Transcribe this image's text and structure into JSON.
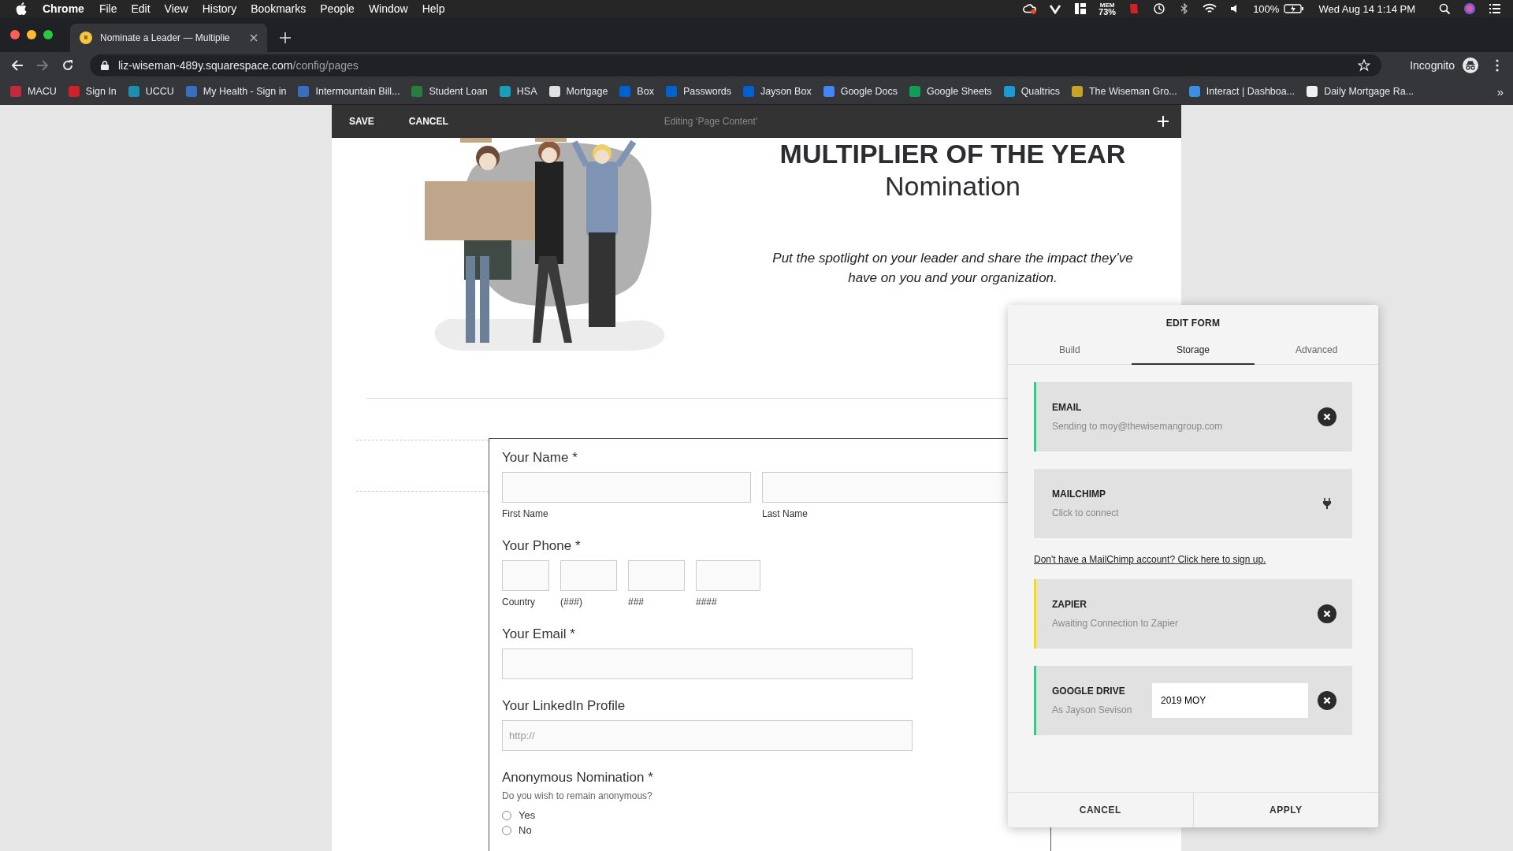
{
  "menu_bar": {
    "app": "Chrome",
    "menus": [
      "File",
      "Edit",
      "View",
      "History",
      "Bookmarks",
      "People",
      "Window",
      "Help"
    ],
    "mem_label": "MEM",
    "mem_value": "73%",
    "battery": "100%",
    "clock": "Wed Aug 14  1:14 PM"
  },
  "browser": {
    "tab_title": "Nominate a Leader — Multiplie",
    "url_host": "liz-wiseman-489y.squarespace.com",
    "url_path": "/config/pages",
    "profile": "Incognito"
  },
  "bookmarks": [
    {
      "label": "MACU",
      "color": "#c8283c"
    },
    {
      "label": "Sign In",
      "color": "#d0202a"
    },
    {
      "label": "UCCU",
      "color": "#1a8fb0"
    },
    {
      "label": "My Health - Sign in",
      "color": "#3a6fc0"
    },
    {
      "label": "Intermountain Bill...",
      "color": "#3a6fc0"
    },
    {
      "label": "Student Loan",
      "color": "#2a7d3c"
    },
    {
      "label": "HSA",
      "color": "#18a0b8"
    },
    {
      "label": "Mortgage",
      "color": "#e0e0e0"
    },
    {
      "label": "Box",
      "color": "#0061d5"
    },
    {
      "label": "Passwords",
      "color": "#0061d5"
    },
    {
      "label": "Jayson Box",
      "color": "#0061d5"
    },
    {
      "label": "Google Docs",
      "color": "#4285f4"
    },
    {
      "label": "Google Sheets",
      "color": "#0f9d58"
    },
    {
      "label": "Qualtrics",
      "color": "#1a9ad6"
    },
    {
      "label": "The Wiseman Gro...",
      "color": "#c9a227"
    },
    {
      "label": "Interact | Dashboa...",
      "color": "#3b8fe0"
    },
    {
      "label": "Daily Mortgage Ra...",
      "color": "#f0f0f0"
    }
  ],
  "more_bookmarks": "»",
  "editor_bar": {
    "save": "SAVE",
    "cancel": "CANCEL",
    "title": "Editing ‘Page Content’"
  },
  "hero": {
    "title": "MULTIPLIER OF THE YEAR",
    "subtitle": "Nomination",
    "tagline": "Put the spotlight on your leader and share the impact they’ve have on you and your organization."
  },
  "form": {
    "fields": [
      {
        "kind": "name",
        "label": "Your Name *",
        "parts": [
          "First Name",
          "Last Name"
        ]
      },
      {
        "kind": "phone",
        "label": "Your Phone *",
        "parts": [
          "Country",
          "(###)",
          "###",
          "####"
        ]
      },
      {
        "kind": "text",
        "label": "Your Email *"
      },
      {
        "kind": "text",
        "label": "Your LinkedIn Profile",
        "placeholder": "http://"
      },
      {
        "kind": "radio",
        "label": "Anonymous Nomination *",
        "description": "Do you wish to remain anonymous?",
        "options": [
          {
            "label": "Yes",
            "selected": false
          },
          {
            "label": "No",
            "selected": false
          }
        ]
      }
    ]
  },
  "edit_panel": {
    "title": "EDIT FORM",
    "tabs": [
      {
        "label": "Build",
        "selected": false
      },
      {
        "label": "Storage",
        "selected": true
      },
      {
        "label": "Advanced",
        "selected": false
      }
    ],
    "items": [
      {
        "kind": "service",
        "name": "EMAIL",
        "detail": "Sending to moy@thewisemangroup.com",
        "color": "#2ecc87",
        "connected": true
      },
      {
        "kind": "service",
        "name": "MAILCHIMP",
        "detail": "Click to connect",
        "connected": false
      },
      {
        "kind": "link",
        "text": "Don't have a MailChimp account? Click here to sign up."
      },
      {
        "kind": "service",
        "name": "ZAPIER",
        "detail": "Awaiting Connection to Zapier",
        "color": "#f5dc0a",
        "connected": true
      },
      {
        "kind": "service",
        "name": "GOOGLE DRIVE",
        "detail": "As Jayson Sevison",
        "color": "#2ecc87",
        "connected": true,
        "value": "2019 MOY"
      }
    ],
    "buttons": [
      "CANCEL",
      "APPLY"
    ]
  }
}
